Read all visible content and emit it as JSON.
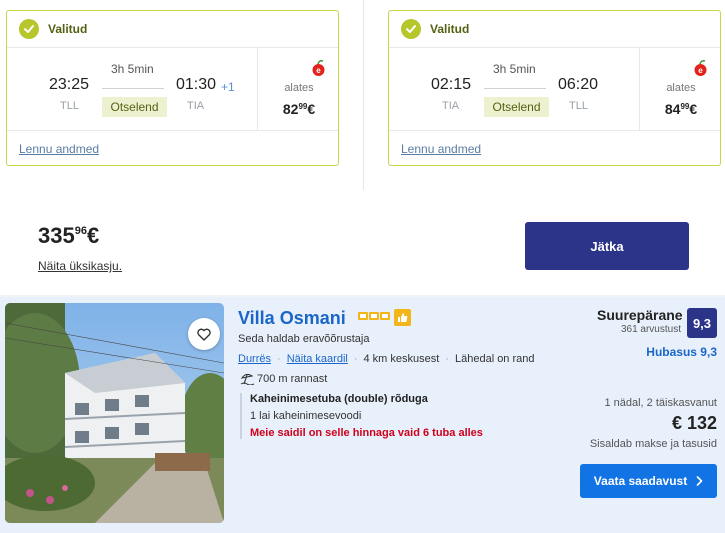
{
  "outbound": {
    "status": "Valitud",
    "duration": "3h 5min",
    "dep_time": "23:25",
    "dep_code": "TLL",
    "arr_time": "01:30",
    "arr_code": "TIA",
    "day_offset": "+1",
    "type": "Otselend",
    "price_prefix": "alates",
    "price_main": "82",
    "price_cents": "99",
    "currency": "€",
    "details_link": "Lennu andmed",
    "airline_icon": "airline-logo-icon"
  },
  "inbound": {
    "status": "Valitud",
    "duration": "3h 5min",
    "dep_time": "02:15",
    "dep_code": "TIA",
    "arr_time": "06:20",
    "arr_code": "TLL",
    "type": "Otselend",
    "price_prefix": "alates",
    "price_main": "84",
    "price_cents": "99",
    "currency": "€",
    "details_link": "Lennu andmed",
    "airline_icon": "airline-logo-icon"
  },
  "summary": {
    "total_main": "335",
    "total_cents": "96",
    "currency": "€",
    "breakdown_link": "Näita üksikasju.",
    "continue_button": "Jätka"
  },
  "hotel": {
    "name": "Villa Osmani",
    "star_count": 3,
    "manager_text": "Seda haldab eravõõrustaja",
    "location_link": "Durrës",
    "map_link": "Näita kaardil",
    "center_distance": "4 km keskusest",
    "beach_note": "Lähedal on rand",
    "beach_distance": "700 m rannast",
    "room_title": "Kaheinimesetuba (double) rõduga",
    "bed_info": "1 lai kaheinimesevoodi",
    "availability": "Meie saidil on selle hinnaga vaid 6 tuba alles",
    "rating_label": "Suurepärane",
    "review_count": "361 arvustust",
    "score": "9,3",
    "comfort": "Hubasus 9,3",
    "stay_info": "1 nädal, 2 täiskasvanut",
    "price": "€ 132",
    "taxes_note": "Sisaldab makse ja tasusid",
    "availability_button": "Vaata saadavust"
  },
  "colors": {
    "selected_green": "#b7c72b",
    "dark_navy": "#2c3489",
    "link_blue": "#1b66c9",
    "cta_blue": "#1273e5",
    "alert_red": "#d0021b",
    "star_yellow": "#f2b61b"
  }
}
